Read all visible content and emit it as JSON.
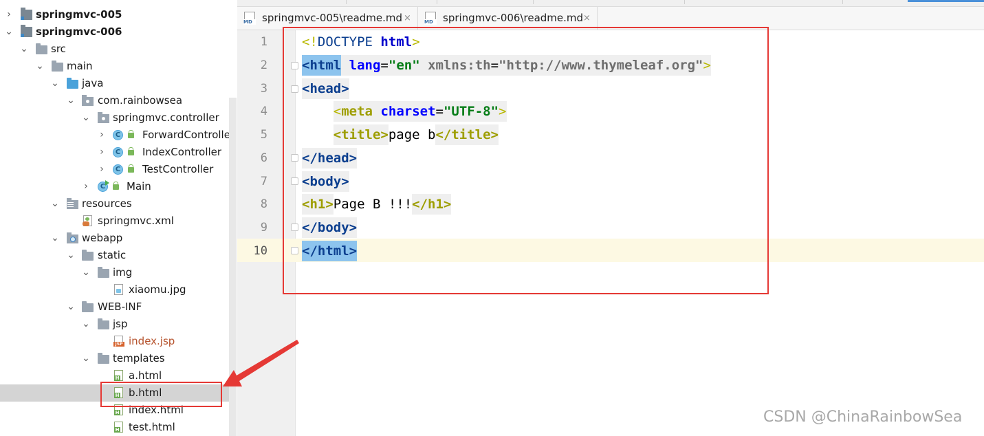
{
  "project_tree": {
    "items": [
      {
        "label": "springmvc-005",
        "bold": true,
        "expanded": false
      },
      {
        "label": "springmvc-006",
        "bold": true,
        "expanded": true
      },
      {
        "label": "src",
        "expanded": true
      },
      {
        "label": "main",
        "expanded": true
      },
      {
        "label": "java",
        "expanded": true
      },
      {
        "label": "com.rainbowsea",
        "expanded": true
      },
      {
        "label": "springmvc.controller",
        "expanded": true
      },
      {
        "label": "ForwardController",
        "expanded": false
      },
      {
        "label": "IndexController",
        "expanded": false
      },
      {
        "label": "TestController",
        "expanded": false
      },
      {
        "label": "Main",
        "expanded": false
      },
      {
        "label": "resources",
        "expanded": true
      },
      {
        "label": "springmvc.xml"
      },
      {
        "label": "webapp",
        "expanded": true
      },
      {
        "label": "static",
        "expanded": true
      },
      {
        "label": "img",
        "expanded": true
      },
      {
        "label": "xiaomu.jpg"
      },
      {
        "label": "WEB-INF",
        "expanded": true
      },
      {
        "label": "jsp",
        "expanded": true
      },
      {
        "label": "index.jsp"
      },
      {
        "label": "templates",
        "expanded": true
      },
      {
        "label": "a.html"
      },
      {
        "label": "b.html",
        "selected": true
      },
      {
        "label": "index.html"
      },
      {
        "label": "test.html"
      }
    ],
    "chevron_expanded": "⌄",
    "chevron_collapsed": "›"
  },
  "editor": {
    "tabs": [
      {
        "label": "springmvc-005\\readme.md",
        "icon": "md-file-icon",
        "close": "×"
      },
      {
        "label": "springmvc-006\\readme.md",
        "icon": "md-file-icon",
        "close": "×"
      }
    ],
    "line_numbers": [
      "1",
      "2",
      "3",
      "4",
      "5",
      "6",
      "7",
      "8",
      "9",
      "10"
    ],
    "current_line": "10",
    "code": {
      "l1_open": "<!",
      "l1_doctype": "DOCTYPE",
      "l1_html": "html",
      "l1_close": ">",
      "l2_tag": "<html",
      "l2_attr_lang": "lang",
      "l2_eq1": "=",
      "l2_val_lang": "\"en\"",
      "l2_attr_ns": "xmlns:th",
      "l2_eq2": "=",
      "l2_val_ns": "\"http://www.thymeleaf.org\"",
      "l2_close": ">",
      "l3": "<head>",
      "l4_open": "<",
      "l4_tag": "meta",
      "l4_attr": "charset",
      "l4_eq": "=",
      "l4_val": "\"UTF-8\"",
      "l4_close": ">",
      "l5_open": "<title>",
      "l5_text": "page b",
      "l5_close": "</title>",
      "l6": "</head>",
      "l7": "<body>",
      "l8_open": "<h1>",
      "l8_text": "Page B !!!",
      "l8_close": "</h1>",
      "l9": "</body>",
      "l10": "</html>"
    }
  },
  "annotation": {
    "arrow_color": "#e53935",
    "box_color": "#e53935"
  },
  "watermark": "CSDN @ChinaRainbowSea",
  "colors": {
    "selection": "#d4d4d4",
    "current_line": "#fdf9e3",
    "tag": "#0c3f8f",
    "attr": "#0000ff",
    "value": "#067d17"
  }
}
